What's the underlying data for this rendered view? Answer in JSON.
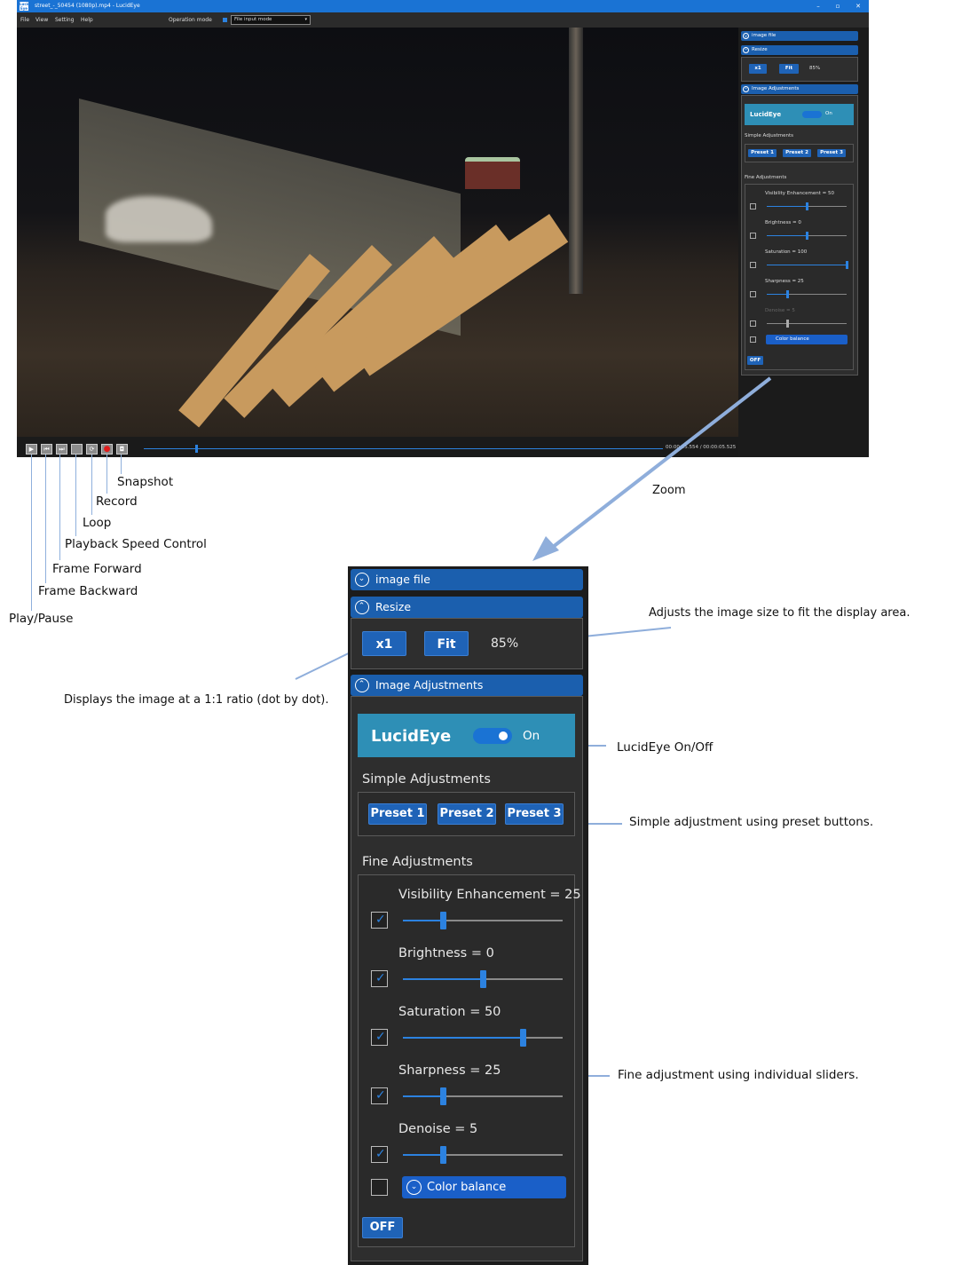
{
  "window": {
    "title": "street_-_50454 (1080p).mp4 - LucidEye",
    "logo_text": "Lucid Eye",
    "menu": [
      "File",
      "View",
      "Setting",
      "Help"
    ],
    "operation_mode_label": "Operation mode",
    "operation_mode_value": "File input mode",
    "timecode": "00:00:05.554 / 00:00:05.525"
  },
  "mini_panel": {
    "image_file": "image file",
    "resize": "Resize",
    "x1": "x1",
    "fit": "Fit",
    "pct": "85%",
    "image_adjustments": "Image Adjustments",
    "luciteye": "LucidEye",
    "on": "On",
    "simple": "Simple Adjustments",
    "presets": [
      "Preset 1",
      "Preset 2",
      "Preset 3"
    ],
    "fine": "Fine Adjustments",
    "sliders": [
      {
        "label": "Visibility Enhancement = 50",
        "value": 50
      },
      {
        "label": "Brightness = 0",
        "value": 50
      },
      {
        "label": "Saturation = 100",
        "value": 100
      },
      {
        "label": "Sharpness = 25",
        "value": 25
      },
      {
        "label": "Denoise = 5",
        "value": 25
      }
    ],
    "color_balance": "Color balance",
    "off": "OFF"
  },
  "annotations": {
    "snapshot": "Snapshot",
    "record": "Record",
    "loop": "Loop",
    "speed": "Playback Speed Control",
    "frame_forward": "Frame Forward",
    "frame_backward": "Frame Backward",
    "play_pause": "Play/Pause",
    "zoom": "Zoom",
    "fit_desc": "Adjusts the image size to fit the display area.",
    "x1_desc": "Displays the image at a 1:1 ratio (dot by dot).",
    "lucid_desc": "LucidEye On/Off",
    "simple_desc": "Simple adjustment using preset buttons.",
    "fine_desc": "Fine adjustment using individual sliders."
  },
  "zoom_panel": {
    "image_file": "image file",
    "resize": "Resize",
    "x1": "x1",
    "fit": "Fit",
    "pct": "85%",
    "image_adjustments": "Image Adjustments",
    "luciteye": "LucidEye",
    "on": "On",
    "simple": "Simple Adjustments",
    "presets": [
      "Preset 1",
      "Preset 2",
      "Preset 3"
    ],
    "fine": "Fine Adjustments",
    "sliders": [
      {
        "label": "Visibility Enhancement = 25",
        "value": 25,
        "checked": true
      },
      {
        "label": "Brightness = 0",
        "value": 50,
        "checked": true
      },
      {
        "label": "Saturation = 50",
        "value": 75,
        "checked": true
      },
      {
        "label": "Sharpness = 25",
        "value": 25,
        "checked": true
      },
      {
        "label": "Denoise = 5",
        "value": 25,
        "checked": true
      }
    ],
    "color_balance": "Color balance",
    "off": "OFF"
  },
  "colors": {
    "accent": "#1a73d4",
    "panel_header": "#1b5fae",
    "lucid_bar": "#2e8fb6"
  }
}
